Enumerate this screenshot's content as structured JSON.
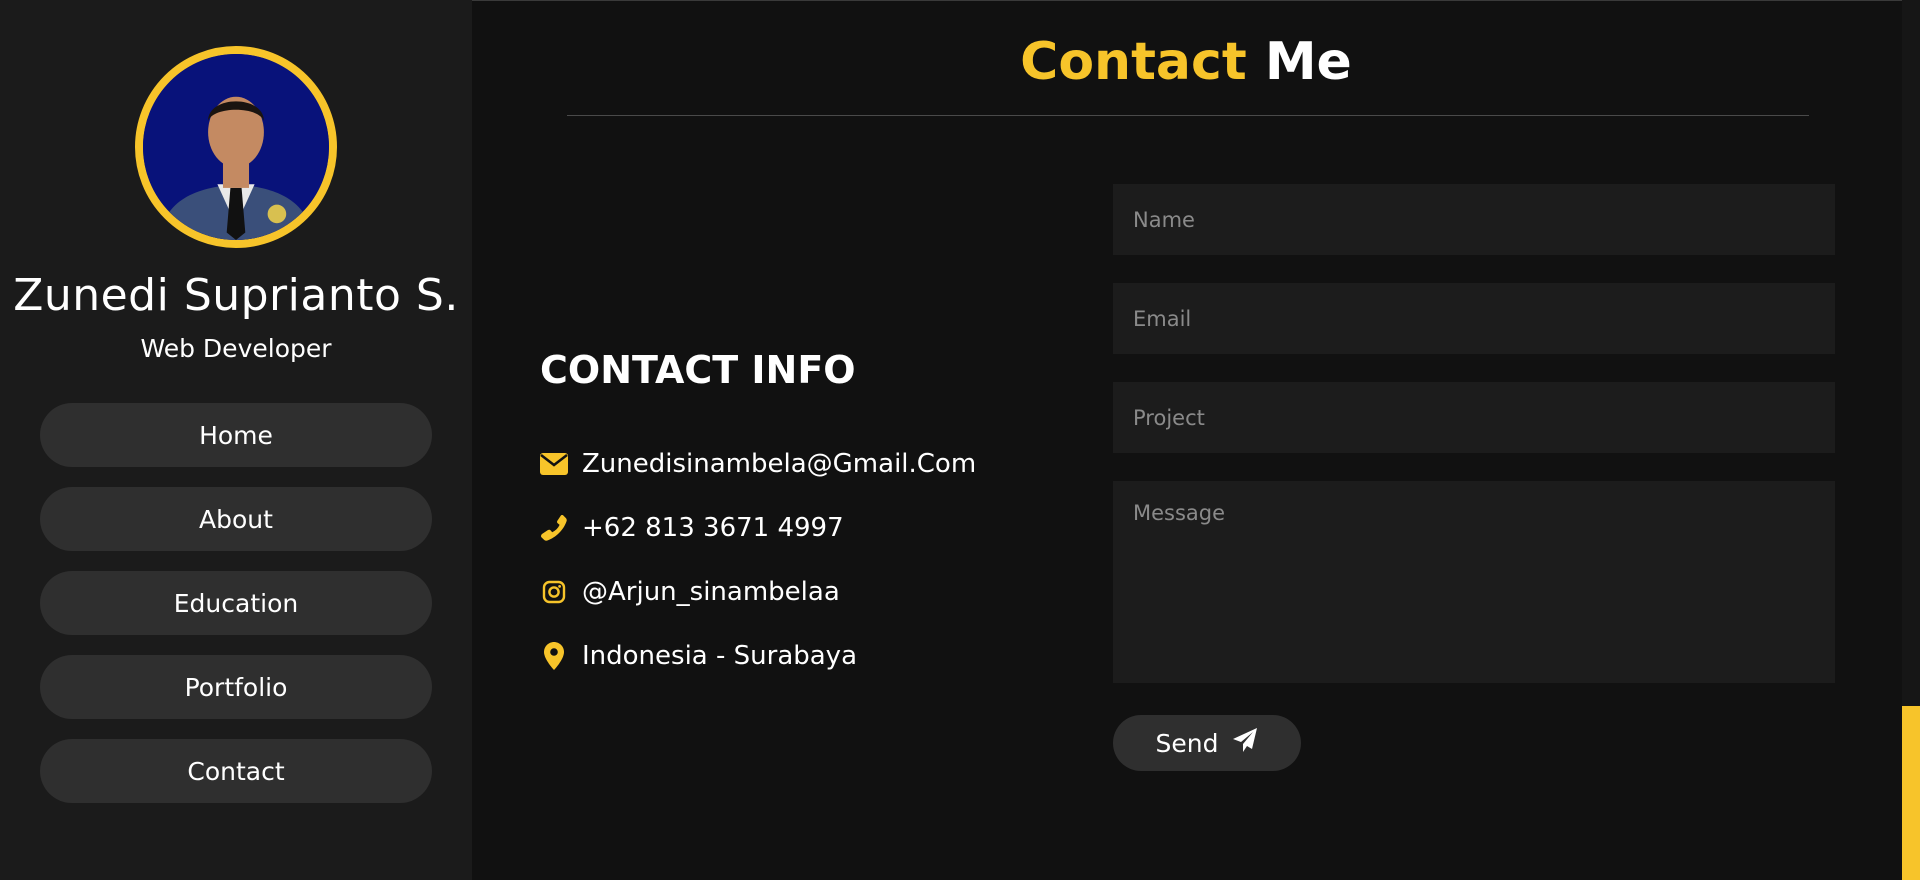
{
  "profile": {
    "name": "Zunedi Suprianto S.",
    "role": "Web Developer"
  },
  "nav": {
    "items": [
      {
        "label": "Home"
      },
      {
        "label": "About"
      },
      {
        "label": "Education"
      },
      {
        "label": "Portfolio"
      },
      {
        "label": "Contact"
      }
    ]
  },
  "page": {
    "title_accent": "Contact",
    "title_rest": "Me"
  },
  "contact_info": {
    "heading": "CONTACT INFO",
    "items": [
      {
        "icon": "envelope-icon",
        "text": "Zunedisinambela@Gmail.Com"
      },
      {
        "icon": "phone-icon",
        "text": "+62 813 3671 4997"
      },
      {
        "icon": "instagram-icon",
        "text": "@Arjun_sinambelaa"
      },
      {
        "icon": "map-pin-icon",
        "text": "Indonesia - Surabaya"
      }
    ]
  },
  "form": {
    "name_placeholder": "Name",
    "email_placeholder": "Email",
    "project_placeholder": "Project",
    "message_placeholder": "Message",
    "send_label": "Send"
  },
  "colors": {
    "accent": "#f7c42a",
    "background": "#111111",
    "sidebar": "#1b1b1b",
    "button": "#2f2f2f"
  }
}
